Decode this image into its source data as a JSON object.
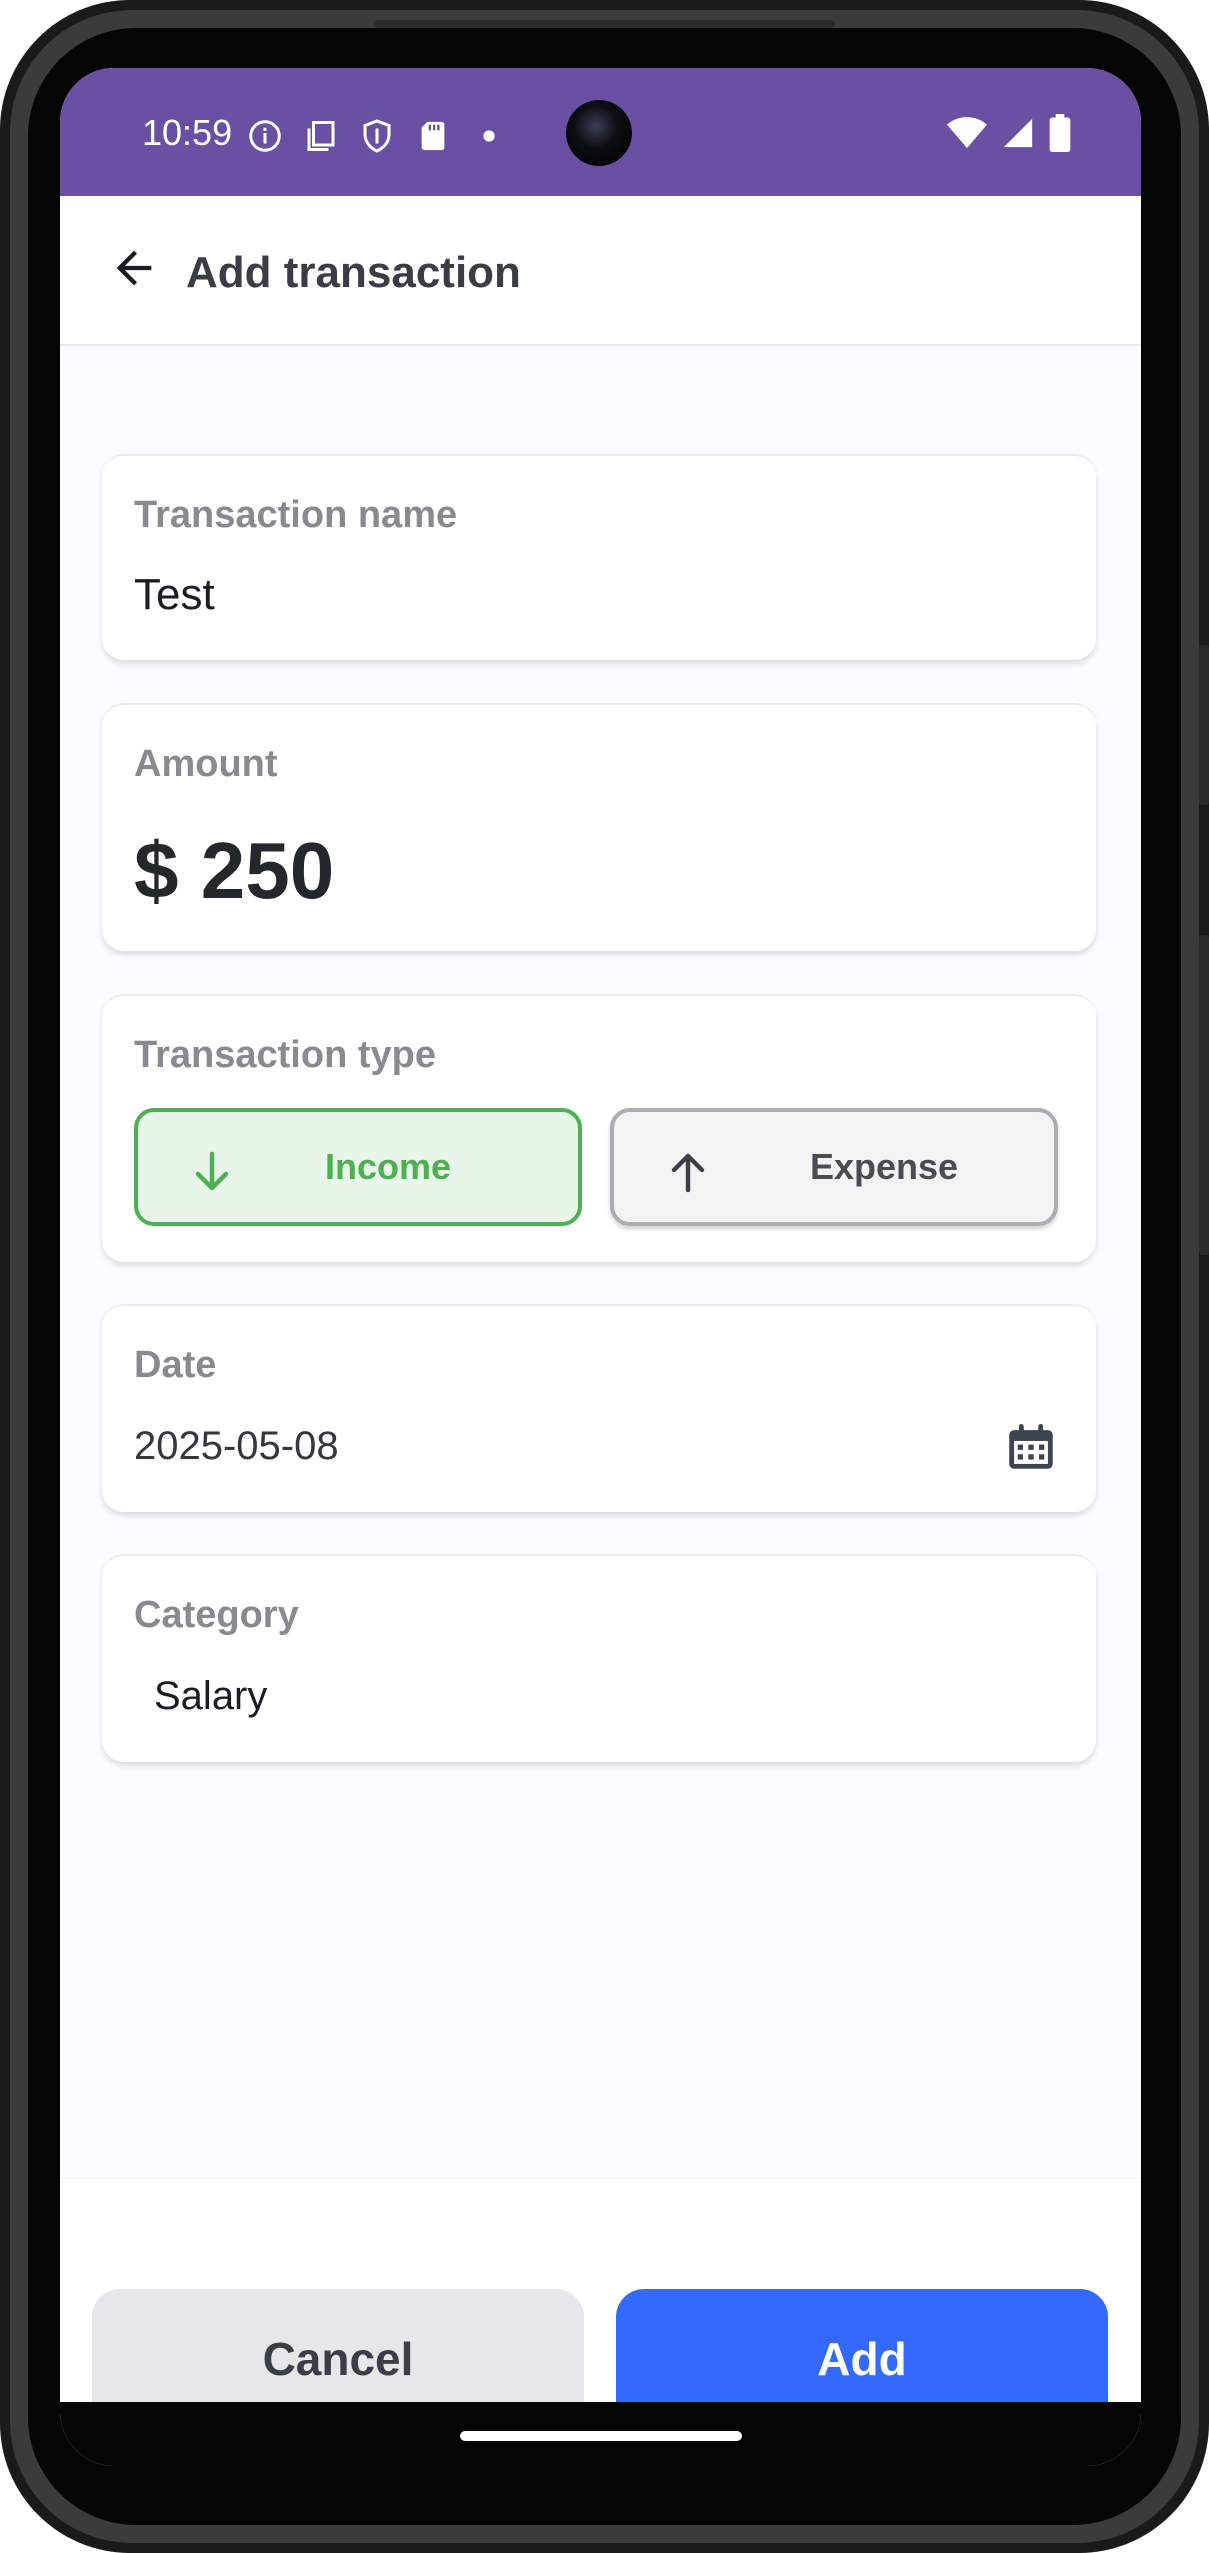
{
  "status_bar": {
    "time": "10:59",
    "icons": [
      "info-icon",
      "clipboard-icon",
      "shield-icon",
      "sd-card-icon",
      "dot-icon",
      "wifi-icon",
      "signal-icon",
      "battery-icon"
    ],
    "color": "#6a50a3"
  },
  "app_bar": {
    "back_icon": "arrow-back-icon",
    "title": "Add transaction"
  },
  "form": {
    "name": {
      "label": "Transaction name",
      "value": "Test"
    },
    "amount": {
      "label": "Amount",
      "currency": "$",
      "value": "250"
    },
    "type": {
      "label": "Transaction type",
      "options": [
        {
          "label": "Income",
          "icon": "arrow-down-icon",
          "selected": true,
          "color": "#4caf50"
        },
        {
          "label": "Expense",
          "icon": "arrow-up-icon",
          "selected": false
        }
      ]
    },
    "date": {
      "label": "Date",
      "value": "2025-05-08",
      "icon": "calendar-icon"
    },
    "category": {
      "label": "Category",
      "value": "Salary"
    }
  },
  "actions": {
    "cancel_label": "Cancel",
    "add_label": "Add",
    "add_color": "#3369ff"
  }
}
